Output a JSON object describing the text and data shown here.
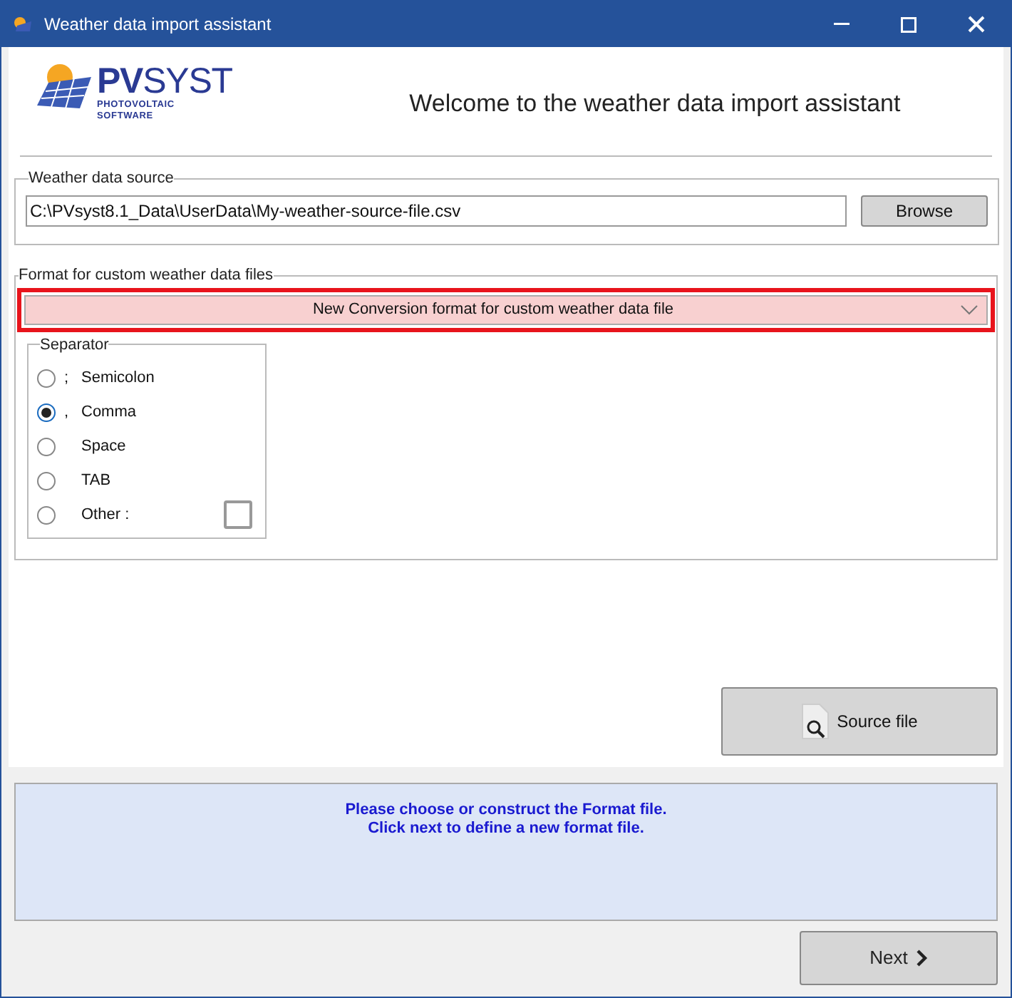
{
  "window": {
    "title": "Weather data import assistant"
  },
  "logo": {
    "wordmark": "**PV**SYST",
    "tagline": [
      "PHOTOVOLTAIC",
      "SOFTWARE"
    ]
  },
  "heading": "Welcome to the weather data import assistant",
  "source_group": {
    "legend": "Weather data source",
    "path": "C:\\PVsyst8.1_Data\\UserData\\My-weather-source-file.csv",
    "button": "Browse"
  },
  "format_group": {
    "legend": "Format for custom weather data files",
    "dropdown": {
      "value": "New Conversion format for custom weather data file",
      "highlighted": true
    },
    "separator": {
      "legend": "Separator",
      "options": [
        {
          "symbol": ";",
          "label": "Semicolon",
          "selected": false
        },
        {
          "symbol": ",",
          "label": "Comma",
          "selected": true
        },
        {
          "label": "Space",
          "selected": false
        },
        {
          "label": "TAB",
          "selected": false
        },
        {
          "label": "Other :",
          "selected": false,
          "kind": "other"
        }
      ]
    }
  },
  "source_file_button": "Source file",
  "info": [
    "Please choose or construct the Format file.",
    "Click next to define a new format file."
  ],
  "next_button": "Next"
}
